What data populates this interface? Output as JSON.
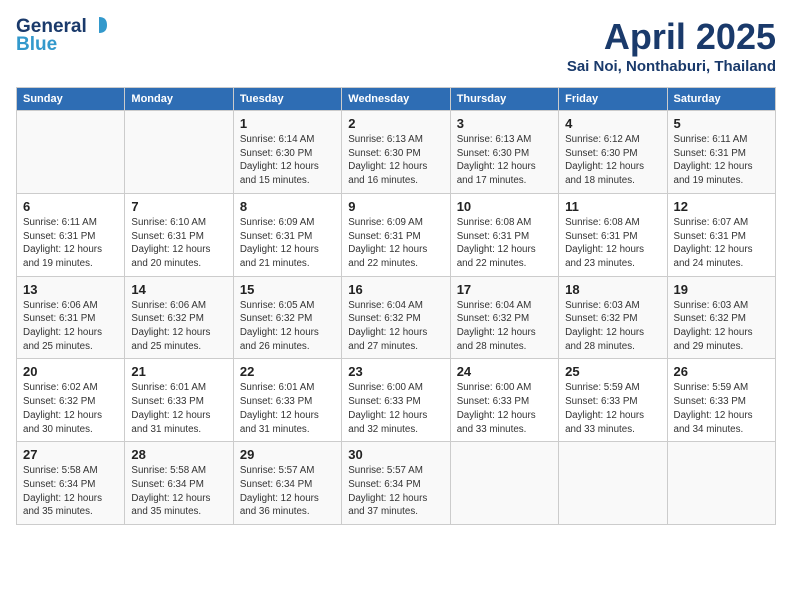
{
  "header": {
    "logo_general": "General",
    "logo_blue": "Blue",
    "title": "April 2025",
    "subtitle": "Sai Noi, Nonthaburi, Thailand"
  },
  "days_of_week": [
    "Sunday",
    "Monday",
    "Tuesday",
    "Wednesday",
    "Thursday",
    "Friday",
    "Saturday"
  ],
  "weeks": [
    [
      {
        "day": "",
        "detail": ""
      },
      {
        "day": "",
        "detail": ""
      },
      {
        "day": "1",
        "detail": "Sunrise: 6:14 AM\nSunset: 6:30 PM\nDaylight: 12 hours\nand 15 minutes."
      },
      {
        "day": "2",
        "detail": "Sunrise: 6:13 AM\nSunset: 6:30 PM\nDaylight: 12 hours\nand 16 minutes."
      },
      {
        "day": "3",
        "detail": "Sunrise: 6:13 AM\nSunset: 6:30 PM\nDaylight: 12 hours\nand 17 minutes."
      },
      {
        "day": "4",
        "detail": "Sunrise: 6:12 AM\nSunset: 6:30 PM\nDaylight: 12 hours\nand 18 minutes."
      },
      {
        "day": "5",
        "detail": "Sunrise: 6:11 AM\nSunset: 6:31 PM\nDaylight: 12 hours\nand 19 minutes."
      }
    ],
    [
      {
        "day": "6",
        "detail": "Sunrise: 6:11 AM\nSunset: 6:31 PM\nDaylight: 12 hours\nand 19 minutes."
      },
      {
        "day": "7",
        "detail": "Sunrise: 6:10 AM\nSunset: 6:31 PM\nDaylight: 12 hours\nand 20 minutes."
      },
      {
        "day": "8",
        "detail": "Sunrise: 6:09 AM\nSunset: 6:31 PM\nDaylight: 12 hours\nand 21 minutes."
      },
      {
        "day": "9",
        "detail": "Sunrise: 6:09 AM\nSunset: 6:31 PM\nDaylight: 12 hours\nand 22 minutes."
      },
      {
        "day": "10",
        "detail": "Sunrise: 6:08 AM\nSunset: 6:31 PM\nDaylight: 12 hours\nand 22 minutes."
      },
      {
        "day": "11",
        "detail": "Sunrise: 6:08 AM\nSunset: 6:31 PM\nDaylight: 12 hours\nand 23 minutes."
      },
      {
        "day": "12",
        "detail": "Sunrise: 6:07 AM\nSunset: 6:31 PM\nDaylight: 12 hours\nand 24 minutes."
      }
    ],
    [
      {
        "day": "13",
        "detail": "Sunrise: 6:06 AM\nSunset: 6:31 PM\nDaylight: 12 hours\nand 25 minutes."
      },
      {
        "day": "14",
        "detail": "Sunrise: 6:06 AM\nSunset: 6:32 PM\nDaylight: 12 hours\nand 25 minutes."
      },
      {
        "day": "15",
        "detail": "Sunrise: 6:05 AM\nSunset: 6:32 PM\nDaylight: 12 hours\nand 26 minutes."
      },
      {
        "day": "16",
        "detail": "Sunrise: 6:04 AM\nSunset: 6:32 PM\nDaylight: 12 hours\nand 27 minutes."
      },
      {
        "day": "17",
        "detail": "Sunrise: 6:04 AM\nSunset: 6:32 PM\nDaylight: 12 hours\nand 28 minutes."
      },
      {
        "day": "18",
        "detail": "Sunrise: 6:03 AM\nSunset: 6:32 PM\nDaylight: 12 hours\nand 28 minutes."
      },
      {
        "day": "19",
        "detail": "Sunrise: 6:03 AM\nSunset: 6:32 PM\nDaylight: 12 hours\nand 29 minutes."
      }
    ],
    [
      {
        "day": "20",
        "detail": "Sunrise: 6:02 AM\nSunset: 6:32 PM\nDaylight: 12 hours\nand 30 minutes."
      },
      {
        "day": "21",
        "detail": "Sunrise: 6:01 AM\nSunset: 6:33 PM\nDaylight: 12 hours\nand 31 minutes."
      },
      {
        "day": "22",
        "detail": "Sunrise: 6:01 AM\nSunset: 6:33 PM\nDaylight: 12 hours\nand 31 minutes."
      },
      {
        "day": "23",
        "detail": "Sunrise: 6:00 AM\nSunset: 6:33 PM\nDaylight: 12 hours\nand 32 minutes."
      },
      {
        "day": "24",
        "detail": "Sunrise: 6:00 AM\nSunset: 6:33 PM\nDaylight: 12 hours\nand 33 minutes."
      },
      {
        "day": "25",
        "detail": "Sunrise: 5:59 AM\nSunset: 6:33 PM\nDaylight: 12 hours\nand 33 minutes."
      },
      {
        "day": "26",
        "detail": "Sunrise: 5:59 AM\nSunset: 6:33 PM\nDaylight: 12 hours\nand 34 minutes."
      }
    ],
    [
      {
        "day": "27",
        "detail": "Sunrise: 5:58 AM\nSunset: 6:34 PM\nDaylight: 12 hours\nand 35 minutes."
      },
      {
        "day": "28",
        "detail": "Sunrise: 5:58 AM\nSunset: 6:34 PM\nDaylight: 12 hours\nand 35 minutes."
      },
      {
        "day": "29",
        "detail": "Sunrise: 5:57 AM\nSunset: 6:34 PM\nDaylight: 12 hours\nand 36 minutes."
      },
      {
        "day": "30",
        "detail": "Sunrise: 5:57 AM\nSunset: 6:34 PM\nDaylight: 12 hours\nand 37 minutes."
      },
      {
        "day": "",
        "detail": ""
      },
      {
        "day": "",
        "detail": ""
      },
      {
        "day": "",
        "detail": ""
      }
    ]
  ]
}
